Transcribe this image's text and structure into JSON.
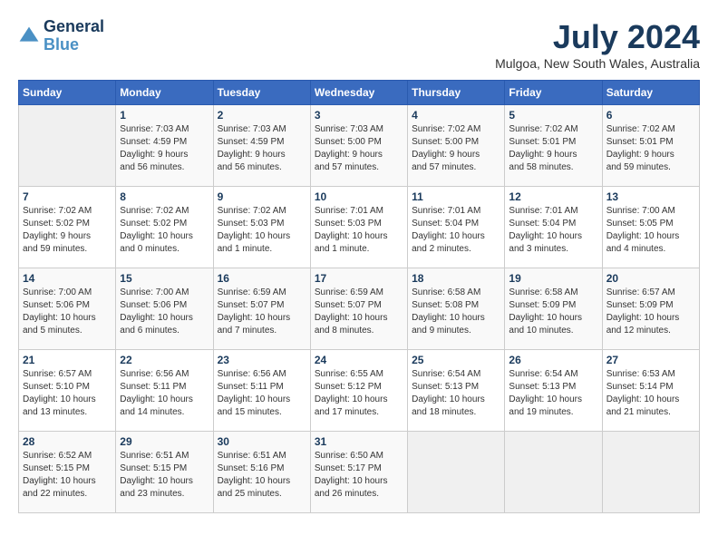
{
  "header": {
    "logo_line1": "General",
    "logo_line2": "Blue",
    "month_year": "July 2024",
    "location": "Mulgoa, New South Wales, Australia"
  },
  "weekdays": [
    "Sunday",
    "Monday",
    "Tuesday",
    "Wednesday",
    "Thursday",
    "Friday",
    "Saturday"
  ],
  "weeks": [
    [
      {
        "day": "",
        "info": ""
      },
      {
        "day": "1",
        "info": "Sunrise: 7:03 AM\nSunset: 4:59 PM\nDaylight: 9 hours\nand 56 minutes."
      },
      {
        "day": "2",
        "info": "Sunrise: 7:03 AM\nSunset: 4:59 PM\nDaylight: 9 hours\nand 56 minutes."
      },
      {
        "day": "3",
        "info": "Sunrise: 7:03 AM\nSunset: 5:00 PM\nDaylight: 9 hours\nand 57 minutes."
      },
      {
        "day": "4",
        "info": "Sunrise: 7:02 AM\nSunset: 5:00 PM\nDaylight: 9 hours\nand 57 minutes."
      },
      {
        "day": "5",
        "info": "Sunrise: 7:02 AM\nSunset: 5:01 PM\nDaylight: 9 hours\nand 58 minutes."
      },
      {
        "day": "6",
        "info": "Sunrise: 7:02 AM\nSunset: 5:01 PM\nDaylight: 9 hours\nand 59 minutes."
      }
    ],
    [
      {
        "day": "7",
        "info": "Sunrise: 7:02 AM\nSunset: 5:02 PM\nDaylight: 9 hours\nand 59 minutes."
      },
      {
        "day": "8",
        "info": "Sunrise: 7:02 AM\nSunset: 5:02 PM\nDaylight: 10 hours\nand 0 minutes."
      },
      {
        "day": "9",
        "info": "Sunrise: 7:02 AM\nSunset: 5:03 PM\nDaylight: 10 hours\nand 1 minute."
      },
      {
        "day": "10",
        "info": "Sunrise: 7:01 AM\nSunset: 5:03 PM\nDaylight: 10 hours\nand 1 minute."
      },
      {
        "day": "11",
        "info": "Sunrise: 7:01 AM\nSunset: 5:04 PM\nDaylight: 10 hours\nand 2 minutes."
      },
      {
        "day": "12",
        "info": "Sunrise: 7:01 AM\nSunset: 5:04 PM\nDaylight: 10 hours\nand 3 minutes."
      },
      {
        "day": "13",
        "info": "Sunrise: 7:00 AM\nSunset: 5:05 PM\nDaylight: 10 hours\nand 4 minutes."
      }
    ],
    [
      {
        "day": "14",
        "info": "Sunrise: 7:00 AM\nSunset: 5:06 PM\nDaylight: 10 hours\nand 5 minutes."
      },
      {
        "day": "15",
        "info": "Sunrise: 7:00 AM\nSunset: 5:06 PM\nDaylight: 10 hours\nand 6 minutes."
      },
      {
        "day": "16",
        "info": "Sunrise: 6:59 AM\nSunset: 5:07 PM\nDaylight: 10 hours\nand 7 minutes."
      },
      {
        "day": "17",
        "info": "Sunrise: 6:59 AM\nSunset: 5:07 PM\nDaylight: 10 hours\nand 8 minutes."
      },
      {
        "day": "18",
        "info": "Sunrise: 6:58 AM\nSunset: 5:08 PM\nDaylight: 10 hours\nand 9 minutes."
      },
      {
        "day": "19",
        "info": "Sunrise: 6:58 AM\nSunset: 5:09 PM\nDaylight: 10 hours\nand 10 minutes."
      },
      {
        "day": "20",
        "info": "Sunrise: 6:57 AM\nSunset: 5:09 PM\nDaylight: 10 hours\nand 12 minutes."
      }
    ],
    [
      {
        "day": "21",
        "info": "Sunrise: 6:57 AM\nSunset: 5:10 PM\nDaylight: 10 hours\nand 13 minutes."
      },
      {
        "day": "22",
        "info": "Sunrise: 6:56 AM\nSunset: 5:11 PM\nDaylight: 10 hours\nand 14 minutes."
      },
      {
        "day": "23",
        "info": "Sunrise: 6:56 AM\nSunset: 5:11 PM\nDaylight: 10 hours\nand 15 minutes."
      },
      {
        "day": "24",
        "info": "Sunrise: 6:55 AM\nSunset: 5:12 PM\nDaylight: 10 hours\nand 17 minutes."
      },
      {
        "day": "25",
        "info": "Sunrise: 6:54 AM\nSunset: 5:13 PM\nDaylight: 10 hours\nand 18 minutes."
      },
      {
        "day": "26",
        "info": "Sunrise: 6:54 AM\nSunset: 5:13 PM\nDaylight: 10 hours\nand 19 minutes."
      },
      {
        "day": "27",
        "info": "Sunrise: 6:53 AM\nSunset: 5:14 PM\nDaylight: 10 hours\nand 21 minutes."
      }
    ],
    [
      {
        "day": "28",
        "info": "Sunrise: 6:52 AM\nSunset: 5:15 PM\nDaylight: 10 hours\nand 22 minutes."
      },
      {
        "day": "29",
        "info": "Sunrise: 6:51 AM\nSunset: 5:15 PM\nDaylight: 10 hours\nand 23 minutes."
      },
      {
        "day": "30",
        "info": "Sunrise: 6:51 AM\nSunset: 5:16 PM\nDaylight: 10 hours\nand 25 minutes."
      },
      {
        "day": "31",
        "info": "Sunrise: 6:50 AM\nSunset: 5:17 PM\nDaylight: 10 hours\nand 26 minutes."
      },
      {
        "day": "",
        "info": ""
      },
      {
        "day": "",
        "info": ""
      },
      {
        "day": "",
        "info": ""
      }
    ]
  ]
}
